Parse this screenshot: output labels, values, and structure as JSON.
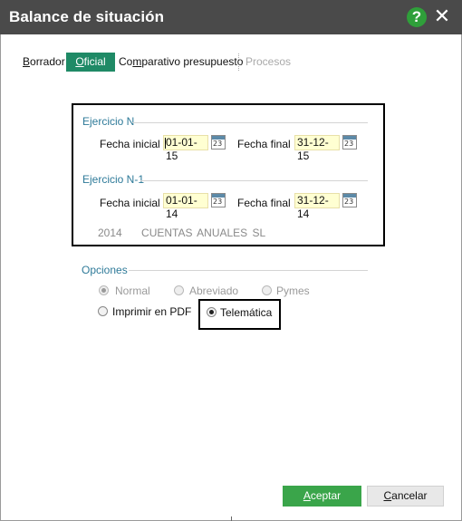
{
  "window": {
    "title": "Balance de situación"
  },
  "tabs": [
    {
      "label_first": "B",
      "label_rest": "orrador"
    },
    {
      "label_first": "O",
      "label_rest": "ficial"
    },
    {
      "label_first": "",
      "label_rest": "Co",
      "label_u": "m",
      "label_tail": "parativo presupuesto"
    },
    {
      "label_first": "",
      "label_rest": "Procesos"
    }
  ],
  "ejercicio_n": {
    "title": "Ejercicio N",
    "fecha_inicial_label": "Fecha inicial",
    "fecha_inicial_value": "01-01-15",
    "fecha_final_label": "Fecha final",
    "fecha_final_value": "31-12-15"
  },
  "ejercicio_n1": {
    "title": "Ejercicio N-1",
    "fecha_inicial_label": "Fecha inicial",
    "fecha_inicial_value": "01-01-14",
    "fecha_final_label": "Fecha final",
    "fecha_final_value": "31-12-14"
  },
  "company": {
    "year": "2014",
    "name": "CUENTAS ANUALES SL"
  },
  "calendar_icon_text": "23",
  "opciones": {
    "title": "Opciones",
    "normal": "Normal",
    "abreviado": "Abreviado",
    "pymes": "Pymes",
    "imprimir_pdf": "Imprimir en PDF",
    "telematica": "Telemática"
  },
  "buttons": {
    "aceptar_first": "A",
    "aceptar_rest": "ceptar",
    "cancelar_first": "C",
    "cancelar_rest": "ancelar"
  },
  "colors": {
    "titlebar": "#4a4a4a",
    "tab_active": "#1f8a66",
    "section_label": "#2e7a99",
    "accept_button": "#3aa54a",
    "date_field": "#ffffd2"
  }
}
